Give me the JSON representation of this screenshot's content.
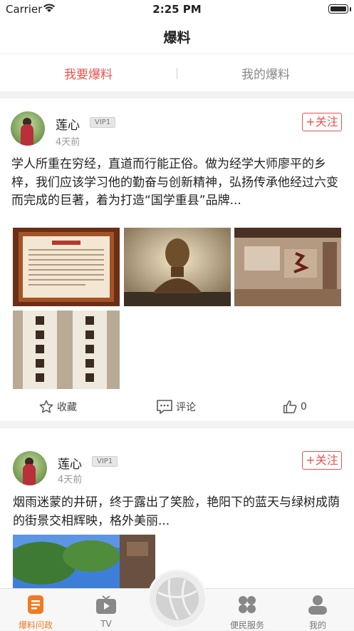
{
  "status_bar": {
    "carrier": "Carrier",
    "time": "2:25 PM"
  },
  "nav": {
    "title": "爆料"
  },
  "segments": {
    "tabs": [
      {
        "label": "我要爆料"
      },
      {
        "label": "我的爆料"
      }
    ],
    "active_color": "#e8534d"
  },
  "posts": [
    {
      "user": "莲心",
      "badge": "VIP1",
      "ago": "4天前",
      "follow_label": "+关注",
      "text": "学人所重在穷经，直道而行能正俗。做为经学大师廖平的乡梓，我们应该学习他的勤奋与创新精神，弘扬传承他经过六变而完成的巨著，着为打造“国学重县”品牌...",
      "images": [
        "wall-plaque-photo",
        "bronze-bust-photo",
        "calligraphy-wall-photo",
        "calligraphy-scrolls-photo"
      ],
      "actions": {
        "favorite_label": "收藏",
        "comment_label": "评论",
        "like_count": "0"
      }
    },
    {
      "user": "莲心",
      "badge": "VIP1",
      "ago": "4天前",
      "follow_label": "+关注",
      "text": "烟雨迷蒙的井研，终于露出了笑脸，艳阳下的蓝天与绿树成荫的街景交相辉映，格外美丽...",
      "images": [
        "street-trees-photo"
      ]
    }
  ],
  "tab_bar": {
    "items": [
      {
        "label": "爆料问政",
        "icon": "news-icon"
      },
      {
        "label": "TV",
        "icon": "tv-icon"
      },
      {
        "label": "便民服务",
        "icon": "grid-icon"
      },
      {
        "label": "我的",
        "icon": "person-icon"
      }
    ],
    "active_color": "#f27b22"
  }
}
